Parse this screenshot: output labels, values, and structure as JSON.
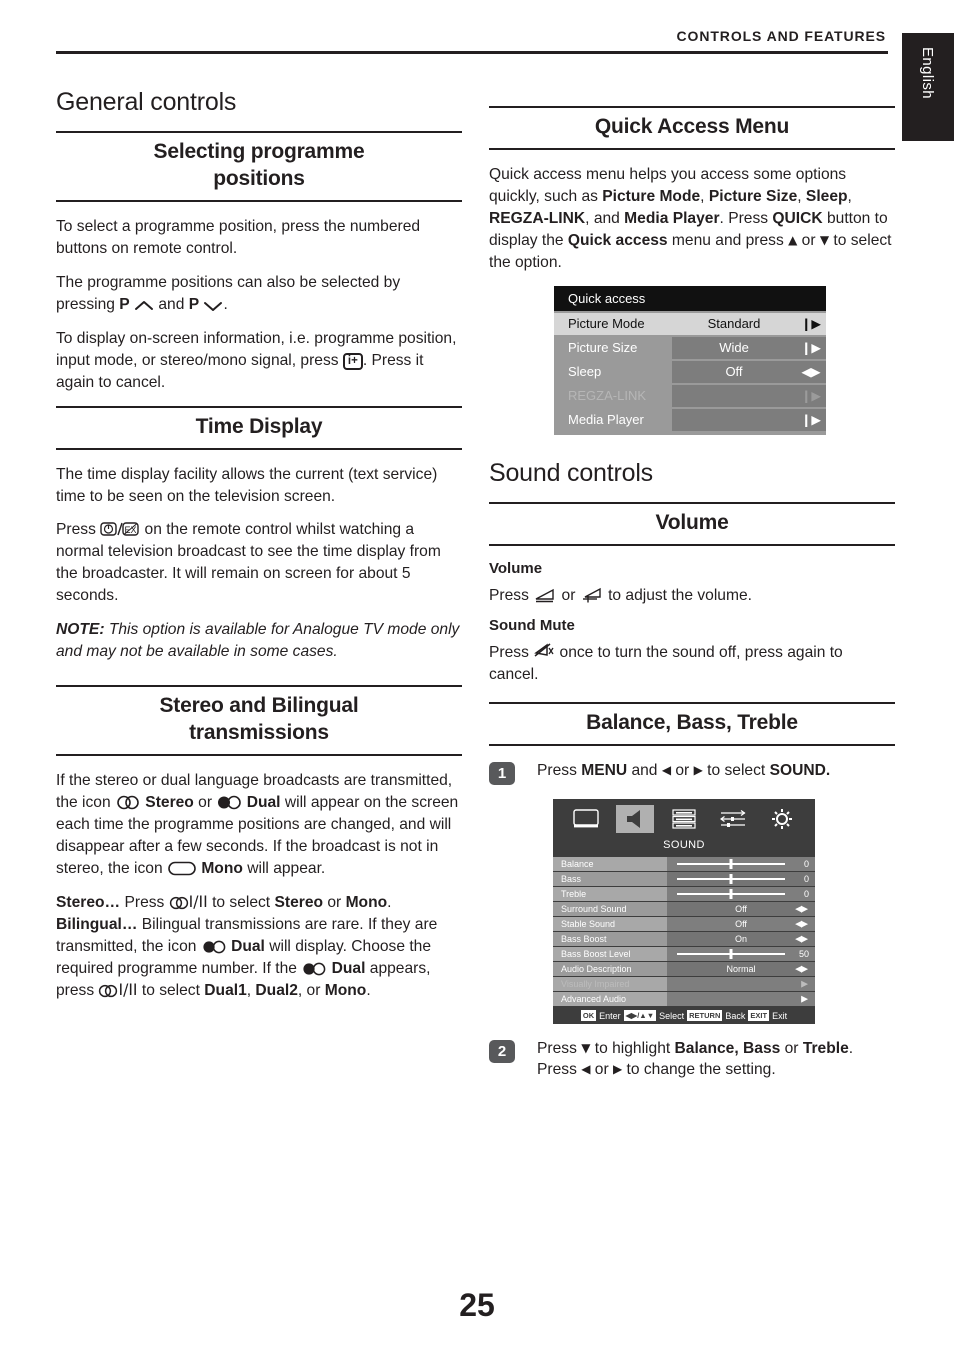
{
  "header": {
    "title": "CONTROLS AND FEATURES",
    "language_tab": "English"
  },
  "page_number": "25",
  "left_column": {
    "section_title": "General controls",
    "sub1": {
      "heading_line1": "Selecting programme",
      "heading_line2": "positions",
      "p1": "To select a programme position, press the numbered buttons on remote control.",
      "p2_a": "The programme positions can also be selected by pressing ",
      "p2_b": "P",
      "p2_c": " and ",
      "p2_d": "P",
      "p2_e": ".",
      "p3_a": "To display on-screen information, i.e. programme position, input mode, or stereo/mono signal, press ",
      "p3_key": "i+",
      "p3_b": ". Press it again to cancel."
    },
    "sub2": {
      "heading": "Time Display",
      "p1": "The time display facility allows the current (text service) time to be seen on the television screen.",
      "p2_a": "Press ",
      "p2_b": " on the remote control whilst watching a normal television broadcast to see the time display from the broadcaster. It will remain on screen for about 5 seconds.",
      "note_label": "NOTE:",
      "note_text": " This option is available for Analogue TV mode only and may not be available in some cases."
    },
    "sub3": {
      "heading_line1": "Stereo and Bilingual",
      "heading_line2": "transmissions",
      "p1_a": "If the stereo or dual language broadcasts are transmitted, the icon ",
      "p1_b": "Stereo",
      "p1_c": " or ",
      "p1_d": "Dual",
      "p1_e": " will appear on the screen each time the programme positions are changed, and will disappear after a few seconds. If the broadcast is not in stereo, the icon ",
      "p1_f": "Mono",
      "p1_g": " will appear.",
      "p2_stereo_label": "Stereo…",
      "p2_stereo_a": " Press ",
      "p2_stereo_ii": "I/II",
      "p2_stereo_b": " to select ",
      "p2_stereo_c": "Stereo",
      "p2_stereo_d": " or ",
      "p2_stereo_e": "Mono",
      "p2_stereo_f": ".",
      "p2_biling_label": "Bilingual…",
      "p2_biling_a": " Bilingual transmissions are rare. If they are transmitted, the icon ",
      "p2_biling_b": "Dual",
      "p2_biling_c": " will display. Choose the required programme number. If the ",
      "p2_biling_d": "Dual",
      "p2_biling_e": " appears, press ",
      "p2_biling_f": " to select ",
      "p2_biling_g": "Dual1",
      "p2_biling_h": ", ",
      "p2_biling_i": "Dual2",
      "p2_biling_j": ", or ",
      "p2_biling_k": "Mono",
      "p2_biling_l": "."
    }
  },
  "right_column": {
    "quick_access": {
      "heading": "Quick Access Menu",
      "p1_a": "Quick access menu helps you access some options quickly, such as ",
      "p1_b": "Picture Mode",
      "p1_c": ", ",
      "p1_d": "Picture Size",
      "p1_e": ", ",
      "p1_f": "Sleep",
      "p1_g": ", ",
      "p1_h": "REGZA-LINK",
      "p1_i": ", and ",
      "p1_j": "Media Player",
      "p1_k": ". Press ",
      "p1_l": "QUICK",
      "p1_m": " button to display the ",
      "p1_n": "Quick access",
      "p1_o": " menu and press ",
      "p1_p": " or ",
      "p1_q": " to select the option."
    },
    "qa_osd": {
      "title": "Quick access",
      "rows": [
        {
          "label": "Picture Mode",
          "value": "Standard",
          "arrow": "right",
          "state": "selected"
        },
        {
          "label": "Picture Size",
          "value": "Wide",
          "arrow": "right",
          "state": "normal"
        },
        {
          "label": "Sleep",
          "value": "Off",
          "arrow": "left-right",
          "state": "normal"
        },
        {
          "label": "REGZA-LINK",
          "value": "",
          "arrow": "right",
          "state": "disabled"
        },
        {
          "label": "Media Player",
          "value": "",
          "arrow": "right",
          "state": "normal"
        }
      ]
    },
    "sound_controls": {
      "section_title": "Sound controls",
      "volume_heading": "Volume",
      "volume_sub": "Volume",
      "volume_p_a": "Press ",
      "volume_p_b": " or ",
      "volume_p_c": " to adjust the volume.",
      "mute_sub": "Sound Mute",
      "mute_p_a": "Press ",
      "mute_p_b": " once to turn the sound off, press again to cancel."
    },
    "bbt": {
      "heading": "Balance, Bass, Treble",
      "step1_num": "1",
      "step1_a": "Press ",
      "step1_menu": "MENU",
      "step1_b": " and ",
      "step1_c": " or ",
      "step1_d": " to select ",
      "step1_sound": "SOUND.",
      "step2_num": "2",
      "step2_a": "Press ",
      "step2_b": " to highlight ",
      "step2_c": "Balance, Bass",
      "step2_d": " or ",
      "step2_e": "Treble",
      "step2_f": ". Press ",
      "step2_g": " or ",
      "step2_h": " to change the setting."
    },
    "sound_osd": {
      "tabs": [
        "picture-icon",
        "sound-icon",
        "features-icon",
        "setup-icon",
        "preferences-icon"
      ],
      "active_tab_index": 1,
      "title": "SOUND",
      "rows": [
        {
          "label": "Balance",
          "type": "slider",
          "value": "0",
          "pos": 50,
          "state": "normal"
        },
        {
          "label": "Bass",
          "type": "slider",
          "value": "0",
          "pos": 50,
          "state": "alt"
        },
        {
          "label": "Treble",
          "type": "slider",
          "value": "0",
          "pos": 50,
          "state": "normal"
        },
        {
          "label": "Surround Sound",
          "type": "option",
          "value": "Off",
          "arrow": "left-right",
          "state": "alt"
        },
        {
          "label": "Stable Sound",
          "type": "option",
          "value": "Off",
          "arrow": "left-right",
          "state": "normal"
        },
        {
          "label": "Bass Boost",
          "type": "option",
          "value": "On",
          "arrow": "left-right",
          "state": "alt"
        },
        {
          "label": "Bass Boost Level",
          "type": "slider",
          "value": "50",
          "pos": 50,
          "state": "normal"
        },
        {
          "label": "Audio Description",
          "type": "option",
          "value": "Normal",
          "arrow": "left-right",
          "state": "alt"
        },
        {
          "label": "Visually Impaired",
          "type": "option",
          "value": "",
          "arrow": "right",
          "state": "dim"
        },
        {
          "label": "Advanced Audio",
          "type": "option",
          "value": "",
          "arrow": "right",
          "state": "normal"
        }
      ],
      "footer": [
        {
          "key": "OK",
          "text": "Enter"
        },
        {
          "key": "NAV",
          "text": "Select"
        },
        {
          "key": "RETURN",
          "text": "Back"
        },
        {
          "key": "EXIT",
          "text": "Exit"
        }
      ]
    }
  },
  "colors": {
    "ink": "#231f20",
    "osd_dark": "#3d3d3d",
    "osd_label": "#a8a8a8",
    "osd_ctl": "#7e7e7e",
    "qa_title": "#111111",
    "qa_selected": "#d6d6d6",
    "step_badge": "#58595b"
  }
}
